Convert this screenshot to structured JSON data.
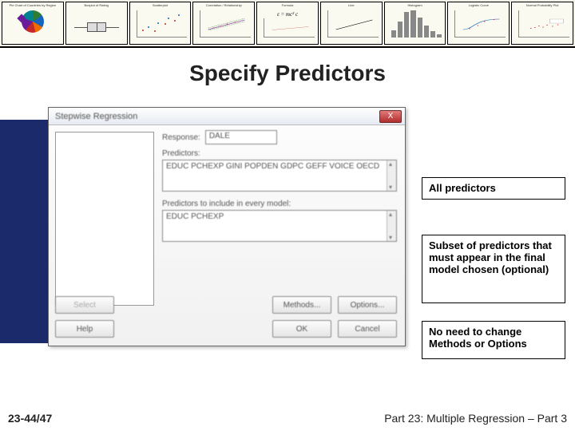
{
  "banner": {
    "thumbs": [
      "Pie Chart of Countries by Region",
      "Boxplot of Rating",
      "Scatterplot",
      "Correlation / Relationship",
      "Formula",
      "Line",
      "Histogram",
      "Logistic Curve",
      "Normal Probability Plot"
    ],
    "formula": "ε = mc²  c"
  },
  "title": "Specify Predictors",
  "dialog": {
    "windowTitle": "Stepwise Regression",
    "closeGlyph": "X",
    "responseLabel": "Response:",
    "responseValue": "DALE",
    "predictorsLabel": "Predictors:",
    "predictorsValue": "EDUC  PCHEXP  GINI  POPDEN  GDPC  GEFF  VOICE OECD",
    "includeLabel": "Predictors to include in every model:",
    "includeValue": "EDUC  PCHEXP",
    "buttons": {
      "select": "Select",
      "methods": "Methods...",
      "options": "Options...",
      "help": "Help",
      "ok": "OK",
      "cancel": "Cancel"
    }
  },
  "callouts": {
    "c1": "All predictors",
    "c2": "Subset of predictors that must appear in the final model chosen (optional)",
    "c3": "No need to change Methods or Options"
  },
  "footer": {
    "left": "23-44/47",
    "right": "Part 23: Multiple Regression – Part 3"
  }
}
